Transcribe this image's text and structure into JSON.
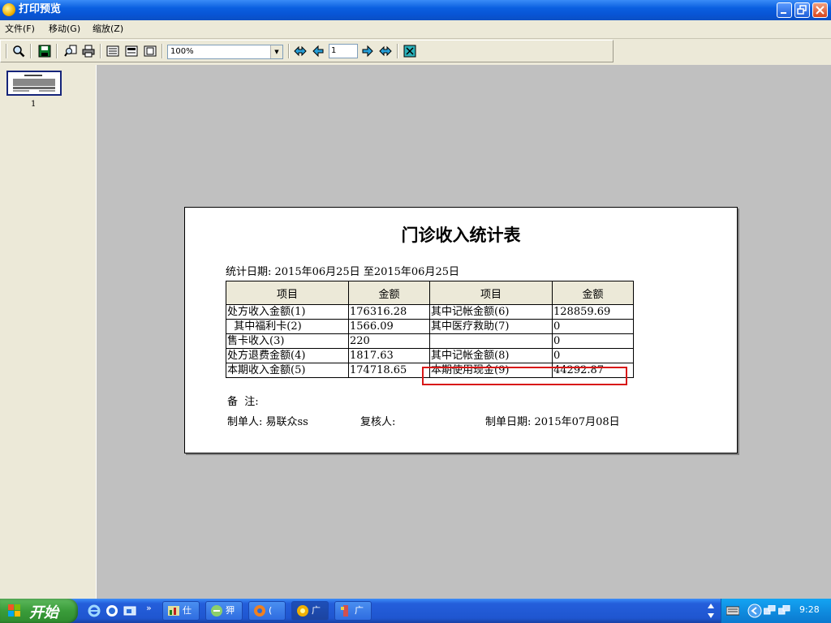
{
  "window": {
    "title": "打印预览"
  },
  "menu": [
    {
      "label": "文件(F)"
    },
    {
      "label": "移动(G)"
    },
    {
      "label": "缩放(Z)"
    }
  ],
  "toolbar": {
    "zoom": "100%",
    "page": "1"
  },
  "thumbnail": {
    "page_label": "1"
  },
  "report": {
    "title": "门诊收入统计表",
    "date_line": "统计日期: 2015年06月25日 至2015年06月25日",
    "headers": [
      "项目",
      "金额",
      "项目",
      "金额"
    ],
    "rows": [
      [
        "处方收入金额(1)",
        "176316.28",
        "其中记帐金额(6)",
        "128859.69"
      ],
      [
        "  其中福利卡(2)",
        "1566.09",
        "其中医疗救助(7)",
        "0"
      ],
      [
        "售卡收入(3)",
        "220",
        "",
        "0"
      ],
      [
        "处方退费金额(4)",
        "1817.63",
        "其中记帐金额(8)",
        "0"
      ],
      [
        "本期收入金额(5)",
        "174718.65",
        "本期使用现金(9)",
        "44292.87"
      ]
    ],
    "note_label": "备  注:",
    "maker": "制单人: 易联众ss",
    "checker": "复核人:",
    "made_date": "制单日期: 2015年07月08日"
  },
  "taskbar": {
    "start": "开始",
    "tasks": [
      {
        "label": "仕"
      },
      {
        "label": "狎"
      },
      {
        "label": "("
      },
      {
        "label": "广"
      },
      {
        "label": "广"
      }
    ],
    "clock": "9:28"
  },
  "colors": {
    "titlebar": "#0a5fe0",
    "highlight_box": "#d81818",
    "preview_bg": "#c0c0c0"
  }
}
